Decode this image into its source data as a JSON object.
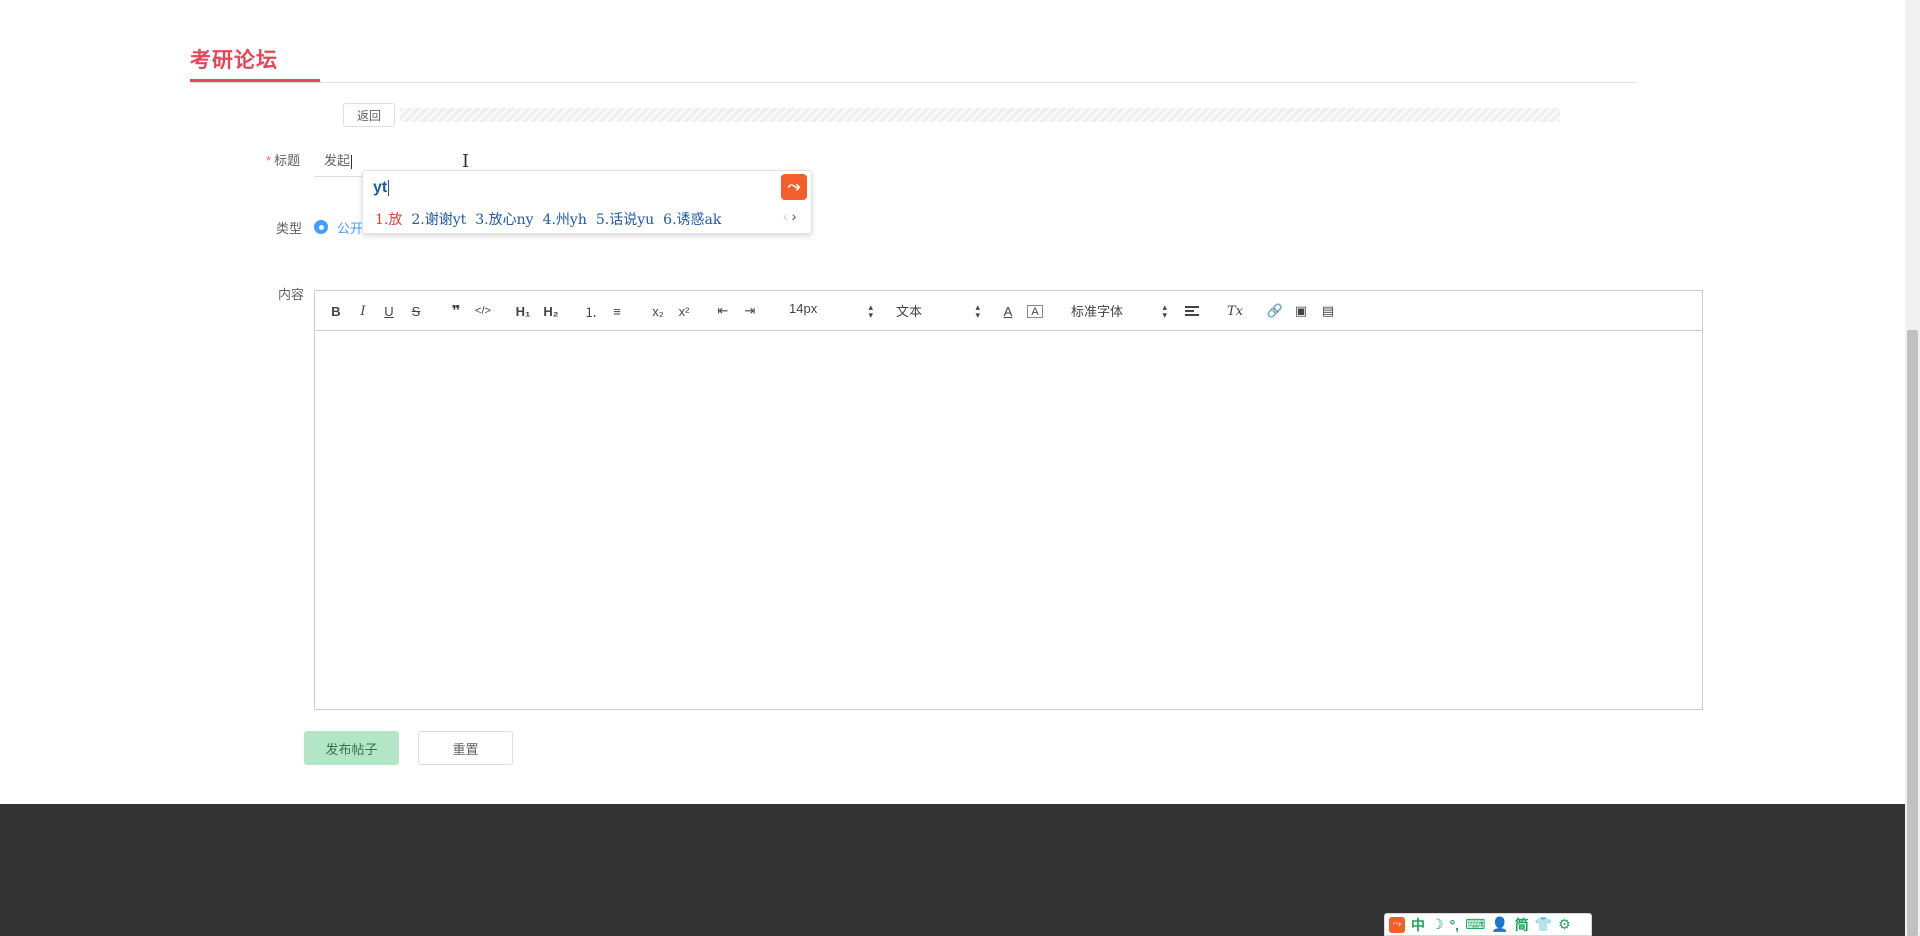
{
  "header": {
    "title": "考研论坛"
  },
  "back_label": "返回",
  "form": {
    "title_label": "标题",
    "title_value": "发起",
    "type_label": "类型",
    "type_option": "公开",
    "content_label": "内容"
  },
  "ime": {
    "input": "yt",
    "candidates": [
      "1.放",
      "2.谢谢yt",
      "3.放心ny",
      "4.州yh",
      "5.话说yu",
      "6.诱惑ak"
    ]
  },
  "toolbar": {
    "bold": "B",
    "italic": "I",
    "underline": "U",
    "strike": "S",
    "quote": "❞",
    "code": "</>",
    "h1": "H₁",
    "h2": "H₂",
    "ordered": "⒈",
    "bullet": "≡",
    "sub": "x₂",
    "sup": "x²",
    "font_size": "14px",
    "block_type": "文本",
    "font_family": "标准字体",
    "color_a": "A",
    "bg_a": "A",
    "clear": "Tx"
  },
  "buttons": {
    "publish": "发布帖子",
    "reset": "重置"
  },
  "statusbar": [
    "中",
    "☽",
    "°,",
    "⌨",
    "👤",
    "简",
    "👕",
    "⚙"
  ],
  "colors": {
    "accent": "#e8455a",
    "primary": "#409eff",
    "footer": "#333333"
  }
}
